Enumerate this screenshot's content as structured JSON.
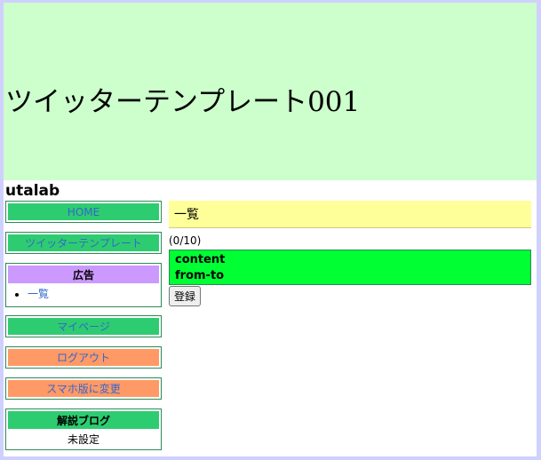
{
  "header": {
    "title": "ツイッターテンプレート001"
  },
  "user": {
    "name": "utalab"
  },
  "sidebar": {
    "home_label": "HOME",
    "template_label": "ツイッターテンプレート",
    "ad": {
      "heading": "広告",
      "items": [
        "一覧"
      ]
    },
    "mypage_label": "マイページ",
    "logout_label": "ログアウト",
    "smartphone_label": "スマホ版に変更",
    "blog": {
      "heading": "解説ブログ",
      "value": "未設定"
    }
  },
  "main": {
    "heading": "一覧",
    "counter": "(0/10)",
    "input_lines": [
      "content",
      "from-to"
    ],
    "register_label": "登録"
  },
  "colors": {
    "page_border": "#d0d0ff",
    "header_bg": "#ccffcc",
    "nav_green": "#2ecc71",
    "nav_orange": "#ff9966",
    "ad_purple": "#cc99ff",
    "heading_yellow": "#ffff99",
    "input_green": "#00ff33",
    "link_blue": "#3366cc"
  }
}
